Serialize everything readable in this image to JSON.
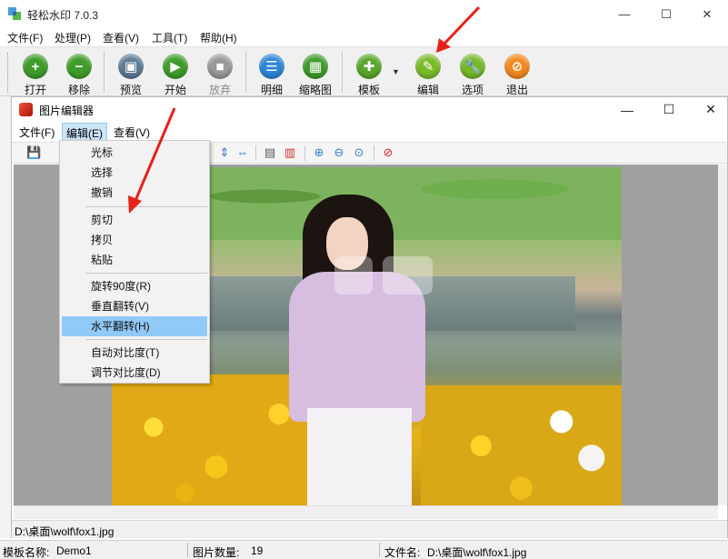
{
  "main_window": {
    "title": "轻松水印 7.0.3",
    "minimize": "—",
    "maximize": "☐",
    "close": "✕"
  },
  "main_menu": [
    "文件(F)",
    "处理(P)",
    "查看(V)",
    "工具(T)",
    "帮助(H)"
  ],
  "toolbar": {
    "buttons": [
      {
        "label": "打开",
        "icon": "plus-icon",
        "color": "#3f9c2a"
      },
      {
        "label": "移除",
        "icon": "minus-icon",
        "color": "#3f9c2a"
      },
      {
        "label": "预览",
        "icon": "preview-icon",
        "color": "#5d7b95"
      },
      {
        "label": "开始",
        "icon": "play-icon",
        "color": "#3f9c2a"
      },
      {
        "label": "放弃",
        "icon": "stop-icon",
        "color": "#9a9a9a"
      },
      {
        "label": "明细",
        "icon": "details-icon",
        "color": "#2d86d6"
      },
      {
        "label": "缩略图",
        "icon": "thumbnail-icon",
        "color": "#3f9c2a"
      },
      {
        "label": "模板",
        "icon": "template-icon",
        "color": "#5aa72c"
      },
      {
        "label": "编辑",
        "icon": "edit-icon",
        "color": "#7bbb2a"
      },
      {
        "label": "选项",
        "icon": "wrench-icon",
        "color": "#77b82a"
      },
      {
        "label": "退出",
        "icon": "exit-icon",
        "color": "#f28a1f"
      }
    ]
  },
  "editor": {
    "title": "图片编辑器",
    "menu": [
      "文件(F)",
      "编辑(E)",
      "查看(V)"
    ],
    "active_menu": "编辑(E)",
    "status_path": "D:\\桌面\\wolf\\fox1.jpg"
  },
  "edit_menu": {
    "groups": [
      [
        "光标",
        "选择",
        "撤销"
      ],
      [
        "剪切",
        "拷贝",
        "粘贴"
      ],
      [
        "旋转90度(R)",
        "垂直翻转(V)",
        "水平翻转(H)"
      ],
      [
        "自动对比度(T)",
        "调节对比度(D)"
      ]
    ],
    "highlighted": "水平翻转(H)"
  },
  "status_bar": {
    "template_label": "模板名称:",
    "template_value": "Demo1",
    "count_label": "图片数量:",
    "count_value": "19",
    "file_label": "文件名:",
    "file_value": "D:\\桌面\\wolf\\fox1.jpg"
  },
  "colors": {
    "menu_highlight": "#91c9f7",
    "arrow": "#e8201a"
  }
}
